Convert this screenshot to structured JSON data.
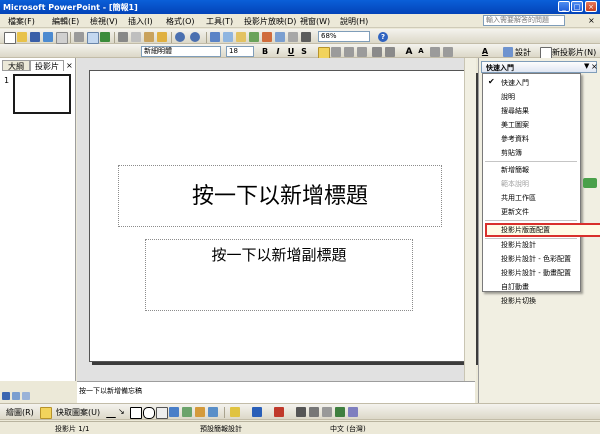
{
  "window": {
    "title": "Microsoft PowerPoint - [簡報1]",
    "min_glyph": "_",
    "max_glyph": "□",
    "close_glyph": "×"
  },
  "menubar": {
    "items": [
      "檔案(F)",
      "編輯(E)",
      "檢視(V)",
      "插入(I)",
      "格式(O)",
      "工具(T)",
      "投影片放映(D)",
      "視窗(W)",
      "說明(H)"
    ],
    "help_placeholder": "輸入需要解答的問題",
    "close_glyph": "×"
  },
  "toolbar_standard": {
    "zoom": "68%",
    "help_glyph": "?"
  },
  "toolbar_format": {
    "font_name": "新細明體",
    "font_size": "18",
    "bold": "B",
    "italic": "I",
    "underline": "U",
    "shadow": "S",
    "grow_font": "A",
    "shrink_font": "A",
    "font_color": "A",
    "design_label": "設計",
    "new_slide_label": "新投影片(N)"
  },
  "left_pane": {
    "tabs": [
      "大綱",
      "投影片"
    ],
    "close_glyph": "×",
    "slide_number": "1"
  },
  "slide": {
    "title_placeholder": "按一下以新增標題",
    "subtitle_placeholder": "按一下以新增副標題"
  },
  "notes_placeholder": "按一下以新增備忘稿",
  "task_pane": {
    "header": "快速入門",
    "menu_groups": [
      [
        {
          "label": "快速入門",
          "checked": true
        },
        {
          "label": "說明"
        },
        {
          "label": "搜尋結果"
        },
        {
          "label": "美工圖案"
        },
        {
          "label": "參考資料"
        },
        {
          "label": "剪貼簿"
        }
      ],
      [
        {
          "label": "新增簡報"
        },
        {
          "label": "範本說明",
          "disabled": true
        },
        {
          "label": "共用工作區"
        },
        {
          "label": "更新文件"
        }
      ],
      [
        {
          "label": "投影片版面配置",
          "highlighted": true
        }
      ],
      [
        {
          "label": "投影片設計"
        },
        {
          "label": "投影片設計 - 色彩配置"
        },
        {
          "label": "投影片設計 - 動畫配置"
        },
        {
          "label": "自訂動畫"
        },
        {
          "label": "投影片切換"
        }
      ]
    ],
    "highlight_color": "#d9302c"
  },
  "drawing_toolbar": {
    "draw_label": "繪圖(R)",
    "autoshapes_label": "快取圖案(U)"
  },
  "status_bar": {
    "slide_count": "投影片 1/1",
    "design": "預設簡報設計",
    "language": "中文 (台灣)"
  }
}
